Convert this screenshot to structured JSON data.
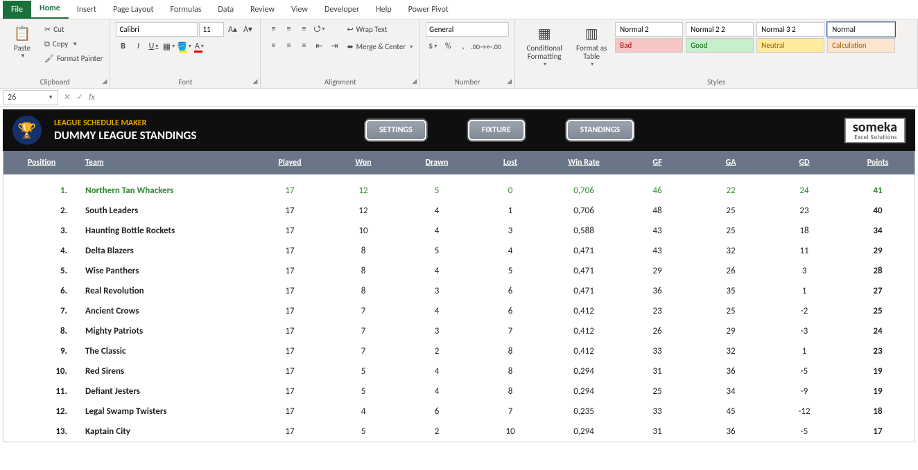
{
  "tabs": {
    "file": "File",
    "items": [
      "Home",
      "Insert",
      "Page Layout",
      "Formulas",
      "Data",
      "Review",
      "View",
      "Developer",
      "Help",
      "Power Pivot"
    ],
    "active": "Home"
  },
  "ribbon": {
    "clipboard": {
      "paste": "Paste",
      "cut": "Cut",
      "copy": "Copy",
      "fmt": "Format Painter",
      "label": "Clipboard"
    },
    "font": {
      "name": "Calibri",
      "size": "11",
      "label": "Font"
    },
    "align": {
      "wrap": "Wrap Text",
      "merge": "Merge & Center",
      "label": "Alignment"
    },
    "number": {
      "format": "General",
      "label": "Number"
    },
    "stylesgrp": {
      "cond": "Conditional Formatting",
      "table": "Format as Table",
      "cells": [
        {
          "txt": "Normal 2",
          "bg": "#ffffff",
          "fg": "#000"
        },
        {
          "txt": "Normal 2 2",
          "bg": "#ffffff",
          "fg": "#000"
        },
        {
          "txt": "Normal 3 2",
          "bg": "#ffffff",
          "fg": "#000"
        },
        {
          "txt": "Normal",
          "bg": "#ffffff",
          "fg": "#000",
          "sel": true
        },
        {
          "txt": "Bad",
          "bg": "#f6c6c6",
          "fg": "#9c0006"
        },
        {
          "txt": "Good",
          "bg": "#c6efce",
          "fg": "#006100"
        },
        {
          "txt": "Neutral",
          "bg": "#ffeb9c",
          "fg": "#9c5700"
        },
        {
          "txt": "Calculation",
          "bg": "#fce4cf",
          "fg": "#a65d00"
        }
      ],
      "label": "Styles"
    }
  },
  "namebox": "26",
  "app": {
    "title1": "LEAGUE SCHEDULE MAKER",
    "title2": "DUMMY LEAGUE STANDINGS",
    "buttons": [
      "SETTINGS",
      "FIXTURE",
      "STANDINGS"
    ],
    "brand1": "someka",
    "brand2": "Excel Solutions"
  },
  "table": {
    "headers": [
      "Position",
      "Team",
      "Played",
      "Won",
      "Drawn",
      "Lost",
      "Win Rate",
      "GF",
      "GA",
      "GD",
      "Points"
    ],
    "rows": [
      {
        "pos": "1.",
        "team": "Northern Tan Whackers",
        "p": "17",
        "w": "12",
        "d": "5",
        "l": "0",
        "wr": "0,706",
        "gf": "46",
        "ga": "22",
        "gd": "24",
        "pts": "41",
        "leader": true
      },
      {
        "pos": "2.",
        "team": "South Leaders",
        "p": "17",
        "w": "12",
        "d": "4",
        "l": "1",
        "wr": "0,706",
        "gf": "48",
        "ga": "25",
        "gd": "23",
        "pts": "40"
      },
      {
        "pos": "3.",
        "team": "Haunting Bottle Rockets",
        "p": "17",
        "w": "10",
        "d": "4",
        "l": "3",
        "wr": "0,588",
        "gf": "43",
        "ga": "25",
        "gd": "18",
        "pts": "34"
      },
      {
        "pos": "4.",
        "team": "Delta Blazers",
        "p": "17",
        "w": "8",
        "d": "5",
        "l": "4",
        "wr": "0,471",
        "gf": "43",
        "ga": "32",
        "gd": "11",
        "pts": "29"
      },
      {
        "pos": "5.",
        "team": "Wise Panthers",
        "p": "17",
        "w": "8",
        "d": "4",
        "l": "5",
        "wr": "0,471",
        "gf": "29",
        "ga": "26",
        "gd": "3",
        "pts": "28"
      },
      {
        "pos": "6.",
        "team": "Real Revolution",
        "p": "17",
        "w": "8",
        "d": "3",
        "l": "6",
        "wr": "0,471",
        "gf": "36",
        "ga": "35",
        "gd": "1",
        "pts": "27"
      },
      {
        "pos": "7.",
        "team": "Ancient Crows",
        "p": "17",
        "w": "7",
        "d": "4",
        "l": "6",
        "wr": "0,412",
        "gf": "23",
        "ga": "25",
        "gd": "-2",
        "pts": "25"
      },
      {
        "pos": "8.",
        "team": "Mighty Patriots",
        "p": "17",
        "w": "7",
        "d": "3",
        "l": "7",
        "wr": "0,412",
        "gf": "26",
        "ga": "29",
        "gd": "-3",
        "pts": "24"
      },
      {
        "pos": "9.",
        "team": "The Classic",
        "p": "17",
        "w": "7",
        "d": "2",
        "l": "8",
        "wr": "0,412",
        "gf": "33",
        "ga": "32",
        "gd": "1",
        "pts": "23"
      },
      {
        "pos": "10.",
        "team": "Red Sirens",
        "p": "17",
        "w": "5",
        "d": "4",
        "l": "8",
        "wr": "0,294",
        "gf": "31",
        "ga": "36",
        "gd": "-5",
        "pts": "19"
      },
      {
        "pos": "11.",
        "team": "Defiant Jesters",
        "p": "17",
        "w": "5",
        "d": "4",
        "l": "8",
        "wr": "0,294",
        "gf": "25",
        "ga": "34",
        "gd": "-9",
        "pts": "19"
      },
      {
        "pos": "12.",
        "team": "Legal Swamp Twisters",
        "p": "17",
        "w": "4",
        "d": "6",
        "l": "7",
        "wr": "0,235",
        "gf": "33",
        "ga": "45",
        "gd": "-12",
        "pts": "18"
      },
      {
        "pos": "13.",
        "team": "Kaptain City",
        "p": "17",
        "w": "5",
        "d": "2",
        "l": "10",
        "wr": "0,294",
        "gf": "31",
        "ga": "36",
        "gd": "-5",
        "pts": "17"
      }
    ]
  }
}
